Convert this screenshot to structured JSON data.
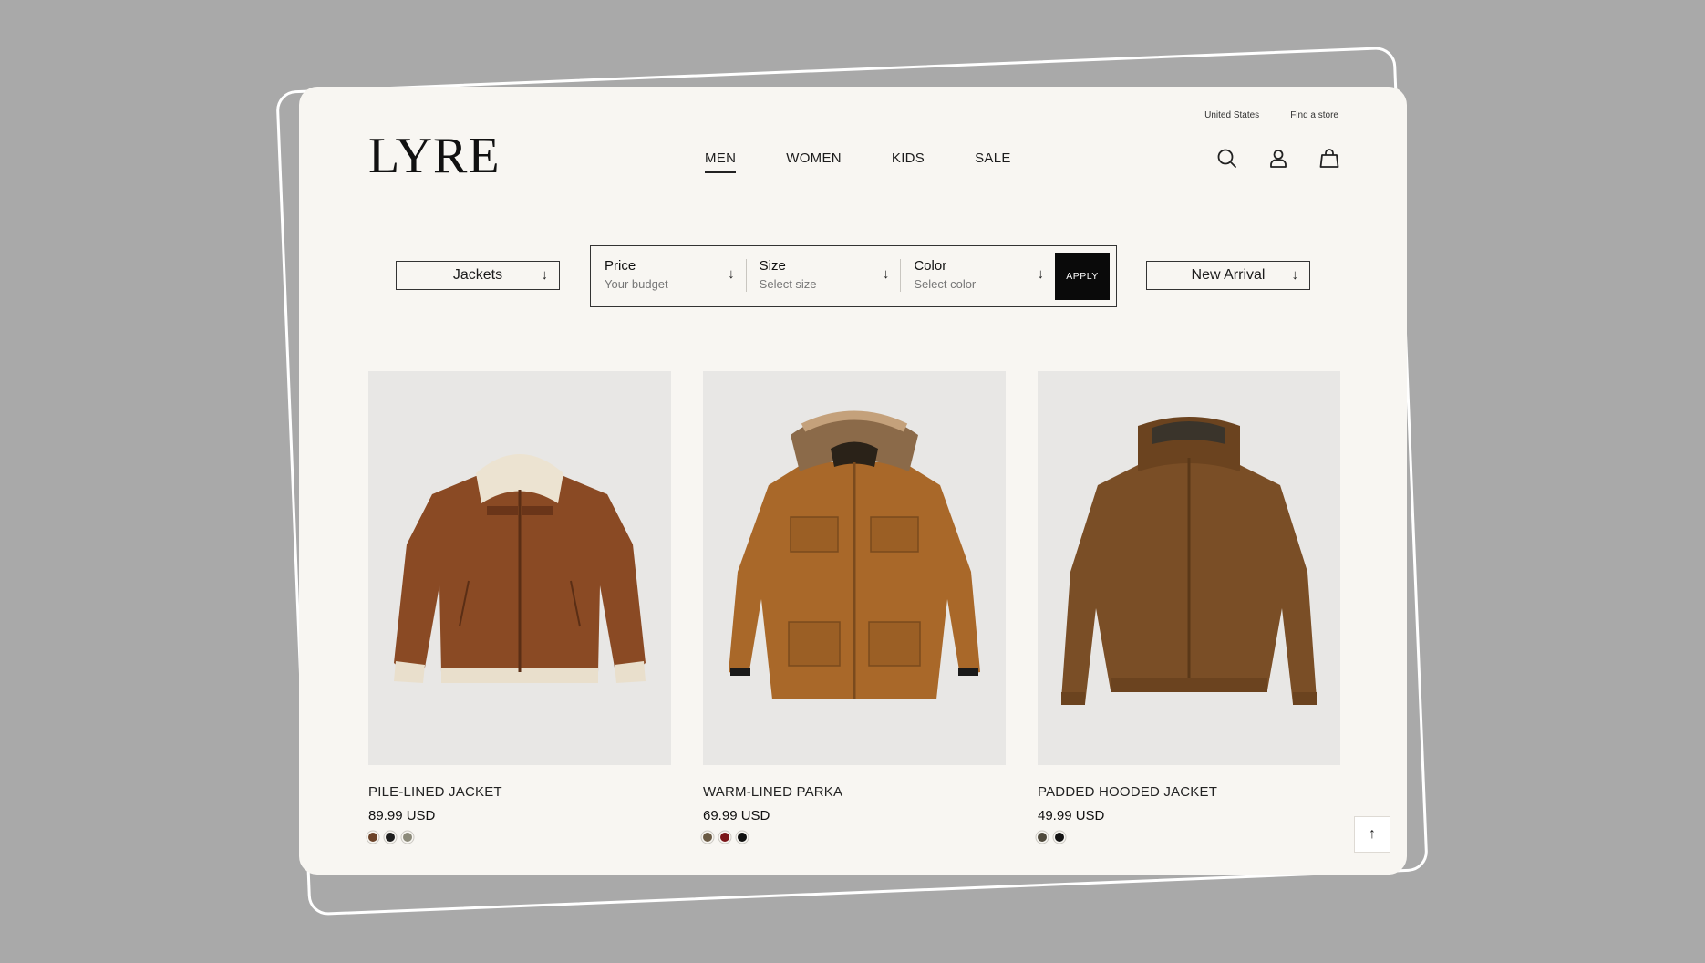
{
  "brand": {
    "logo": "LYRE"
  },
  "top_links": {
    "region": "United States",
    "find_store": "Find a store"
  },
  "nav": [
    {
      "label": "MEN",
      "active": true
    },
    {
      "label": "WOMEN",
      "active": false
    },
    {
      "label": "KIDS",
      "active": false
    },
    {
      "label": "SALE",
      "active": false
    }
  ],
  "header_icons": [
    "search-icon",
    "user-icon",
    "bag-icon"
  ],
  "filters": {
    "category": "Jackets",
    "price": {
      "label": "Price",
      "placeholder": "Your budget"
    },
    "size": {
      "label": "Size",
      "placeholder": "Select size"
    },
    "color": {
      "label": "Color",
      "placeholder": "Select color"
    },
    "apply_label": "APPLY",
    "sort": "New Arrival",
    "arrow": "↓"
  },
  "products": [
    {
      "name": "PILE-LINED JACKET",
      "price": "89.99 USD",
      "colors": [
        "#6b4228",
        "#1f1f1f",
        "#8c8a7a"
      ]
    },
    {
      "name": "WARM-LINED PARKA",
      "price": "69.99 USD",
      "colors": [
        "#6b5b45",
        "#7a1518",
        "#101010"
      ]
    },
    {
      "name": "PADDED HOODED JACKET",
      "price": "49.99 USD",
      "colors": [
        "#4f4a3d",
        "#141414"
      ]
    }
  ],
  "back_to_top": "↑",
  "colors": {
    "page_bg": "#a9a9a9",
    "card_bg": "#f8f6f2",
    "accent": "#0a0a0a"
  }
}
